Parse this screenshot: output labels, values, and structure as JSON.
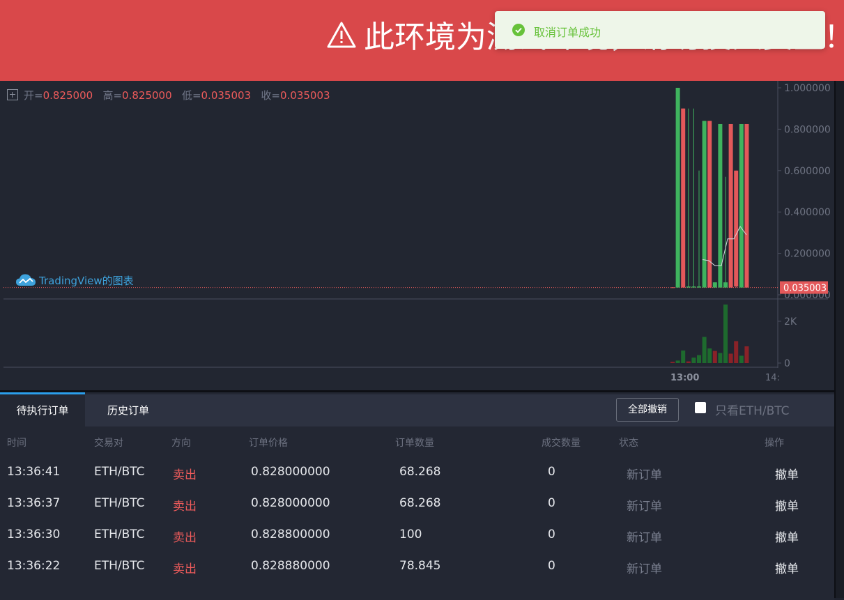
{
  "banner": {
    "title": "此环境为测试环境，请勿投入资金！"
  },
  "toast": {
    "message": "取消订单成功"
  },
  "chart": {
    "ohlc": {
      "open_label": "开=",
      "open": "0.825000",
      "high_label": "高=",
      "high": "0.825000",
      "low_label": "低=",
      "low": "0.035003",
      "close_label": "收=",
      "close": "0.035003"
    },
    "watermark": "TradingView的图表",
    "price_ticks": [
      "1.000000",
      "0.800000",
      "0.600000",
      "0.400000",
      "0.200000",
      "0.000000"
    ],
    "last_price": "0.035003",
    "volume_ticks": [
      "2K",
      "0"
    ],
    "time_ticks": [
      "13:00",
      "14:"
    ],
    "colors": {
      "up": "#3fb35e",
      "down": "#e3585a",
      "vol_up": "#1e6a2e",
      "vol_down": "#8a2228"
    }
  },
  "chart_data": {
    "type": "candlestick",
    "price_range": [
      0,
      1
    ],
    "volume_range": [
      0,
      3000
    ],
    "candles": [
      {
        "dir": "down",
        "open": 0.036,
        "close": 0.035,
        "high": 0.036,
        "low": 0.035
      },
      {
        "dir": "up",
        "open": 0.035,
        "close": 1.0,
        "high": 1.0,
        "low": 0.035
      },
      {
        "dir": "down",
        "open": 0.9,
        "close": 0.035,
        "high": 0.9,
        "low": 0.035
      },
      {
        "dir": "up",
        "open": 0.035,
        "close": 0.04,
        "high": 0.9,
        "low": 0.035
      },
      {
        "dir": "up",
        "open": 0.035,
        "close": 0.04,
        "high": 0.9,
        "low": 0.035
      },
      {
        "dir": "up",
        "open": 0.035,
        "close": 0.04,
        "high": 0.6,
        "low": 0.035
      },
      {
        "dir": "up",
        "open": 0.035,
        "close": 0.84,
        "high": 0.84,
        "low": 0.035
      },
      {
        "dir": "down",
        "open": 0.84,
        "close": 0.035,
        "high": 0.84,
        "low": 0.035
      },
      {
        "dir": "up",
        "open": 0.035,
        "close": 0.06,
        "high": 0.06,
        "low": 0.035
      },
      {
        "dir": "up",
        "open": 0.035,
        "close": 0.825,
        "high": 0.825,
        "low": 0.035
      },
      {
        "dir": "up",
        "open": 0.035,
        "close": 0.06,
        "high": 0.57,
        "low": 0.035
      },
      {
        "dir": "down",
        "open": 0.825,
        "close": 0.035,
        "high": 0.825,
        "low": 0.035
      },
      {
        "dir": "down",
        "open": 0.6,
        "close": 0.04,
        "high": 0.6,
        "low": 0.035
      },
      {
        "dir": "up",
        "open": 0.035,
        "close": 0.825,
        "high": 0.825,
        "low": 0.035
      },
      {
        "dir": "down",
        "open": 0.825,
        "close": 0.035,
        "high": 0.825,
        "low": 0.035
      }
    ],
    "volumes": [
      {
        "dir": "down",
        "v": 60
      },
      {
        "dir": "up",
        "v": 120
      },
      {
        "dir": "up",
        "v": 600
      },
      {
        "dir": "down",
        "v": 80
      },
      {
        "dir": "up",
        "v": 260
      },
      {
        "dir": "up",
        "v": 380
      },
      {
        "dir": "up",
        "v": 1250
      },
      {
        "dir": "up",
        "v": 700
      },
      {
        "dir": "down",
        "v": 580
      },
      {
        "dir": "up",
        "v": 480
      },
      {
        "dir": "up",
        "v": 2800
      },
      {
        "dir": "down",
        "v": 450
      },
      {
        "dir": "down",
        "v": 1050
      },
      {
        "dir": "up",
        "v": 350
      },
      {
        "dir": "down",
        "v": 800
      }
    ],
    "ma_line": [
      0.17,
      0.165,
      0.14,
      0.14,
      0.27,
      0.27,
      0.33,
      0.29
    ]
  },
  "orders": {
    "tabs": [
      "待执行订单",
      "历史订单"
    ],
    "cancel_all": "全部撤销",
    "filter_label": "只看ETH/BTC",
    "columns": [
      "时间",
      "交易对",
      "方向",
      "订单价格",
      "订单数量",
      "成交数量",
      "状态",
      "操作"
    ],
    "rows": [
      {
        "time": "13:36:41",
        "pair": "ETH/BTC",
        "side": "卖出",
        "price": "0.828000000",
        "amount": "68.268",
        "filled": "0",
        "status": "新订单",
        "action": "撤单"
      },
      {
        "time": "13:36:37",
        "pair": "ETH/BTC",
        "side": "卖出",
        "price": "0.828000000",
        "amount": "68.268",
        "filled": "0",
        "status": "新订单",
        "action": "撤单"
      },
      {
        "time": "13:36:30",
        "pair": "ETH/BTC",
        "side": "卖出",
        "price": "0.828800000",
        "amount": "100",
        "filled": "0",
        "status": "新订单",
        "action": "撤单"
      },
      {
        "time": "13:36:22",
        "pair": "ETH/BTC",
        "side": "卖出",
        "price": "0.828880000",
        "amount": "78.845",
        "filled": "0",
        "status": "新订单",
        "action": "撤单"
      }
    ]
  }
}
